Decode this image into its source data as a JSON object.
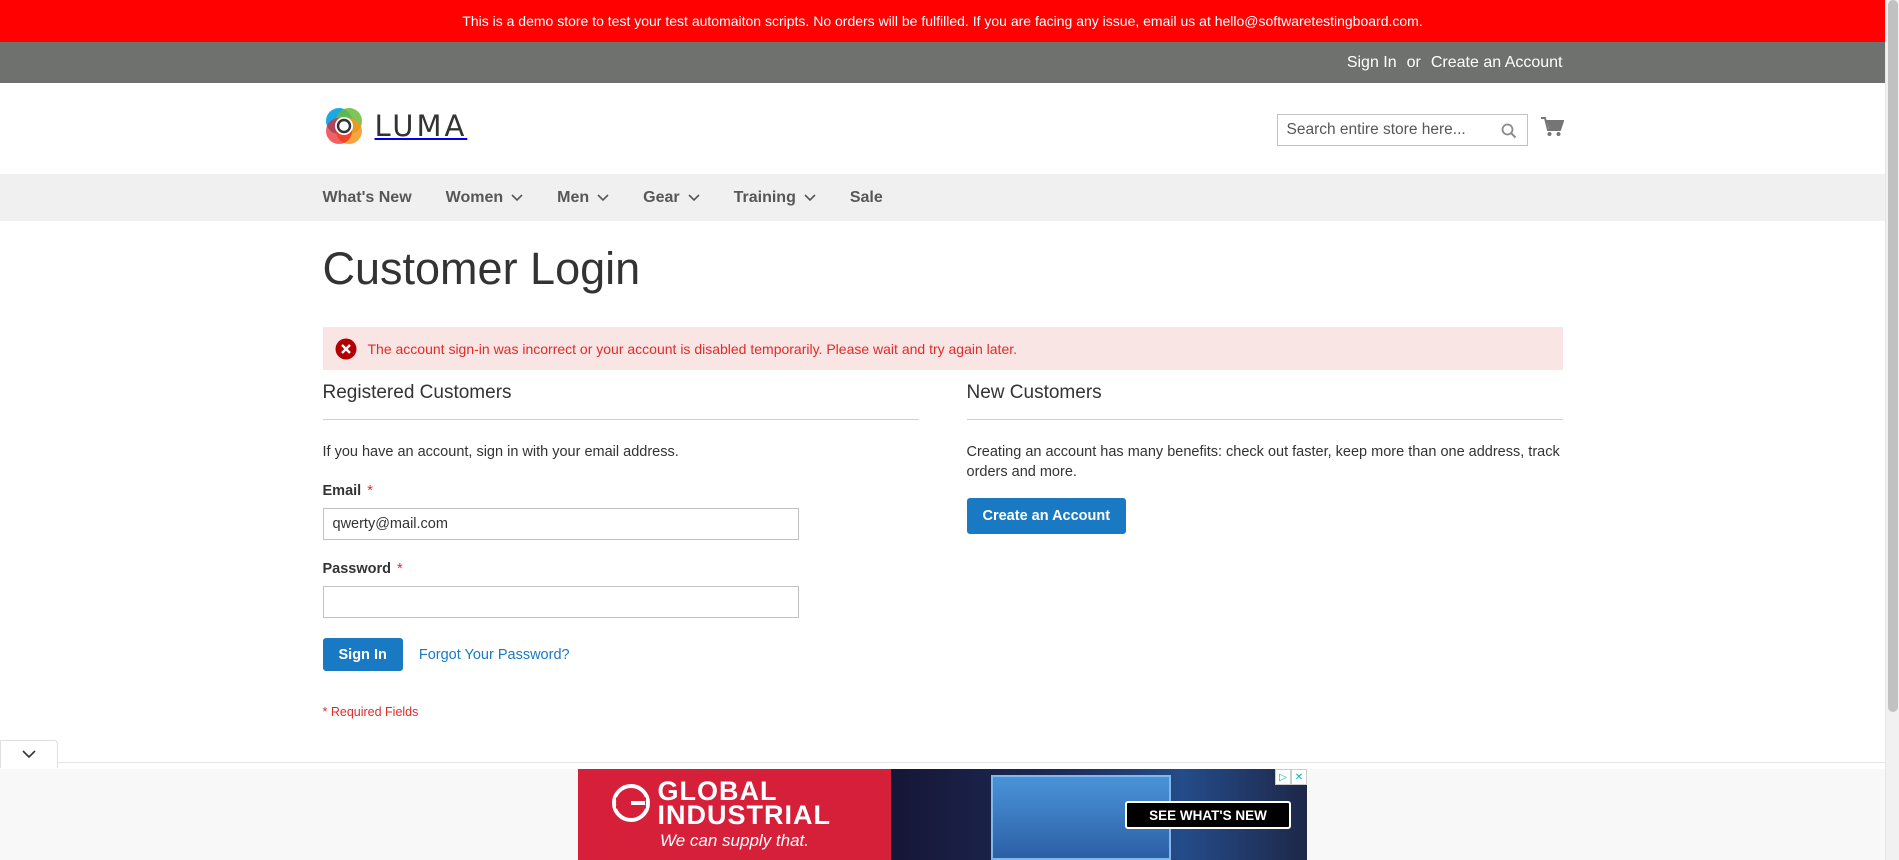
{
  "demo_notice": "This is a demo store to test your test automaiton scripts. No orders will be fulfilled. If you are facing any issue, email us at hello@softwaretestingboard.com.",
  "header_links": {
    "sign_in": "Sign In",
    "or": "or",
    "create_account": "Create an Account"
  },
  "logo": {
    "text": "LUMA"
  },
  "search": {
    "placeholder": "Search entire store here...",
    "value": ""
  },
  "nav": {
    "items": [
      {
        "label": "What's New",
        "has_dropdown": false
      },
      {
        "label": "Women",
        "has_dropdown": true
      },
      {
        "label": "Men",
        "has_dropdown": true
      },
      {
        "label": "Gear",
        "has_dropdown": true
      },
      {
        "label": "Training",
        "has_dropdown": true
      },
      {
        "label": "Sale",
        "has_dropdown": false
      }
    ]
  },
  "page": {
    "title": "Customer Login",
    "error_message": "The account sign-in was incorrect or your account is disabled temporarily. Please wait and try again later."
  },
  "registered": {
    "title": "Registered Customers",
    "intro": "If you have an account, sign in with your email address.",
    "email_label": "Email",
    "email_value": "qwerty@mail.com",
    "password_label": "Password",
    "password_value": "",
    "required_mark": "*",
    "sign_in_button": "Sign In",
    "forgot_link": "Forgot Your Password?",
    "required_note": "* Required Fields"
  },
  "new_customers": {
    "title": "New Customers",
    "text": "Creating an account has many benefits: check out faster, keep more than one address, track orders and more.",
    "button": "Create an Account"
  },
  "ad": {
    "brand": "GLOBAL INDUSTRIAL",
    "tagline": "We can supply that.",
    "cta": "SEE WHAT'S NEW"
  },
  "colors": {
    "demo_bar": "#ff0101",
    "header_bar": "#6e716e",
    "primary": "#1979c3",
    "error_text": "#e02b27",
    "error_bg": "#fae5e5",
    "nav_bg": "#f0f0f0"
  },
  "icons": {
    "search": "search-icon",
    "cart": "cart-icon",
    "error": "error-icon",
    "dropdown": "chevron-down-icon",
    "collapse": "chevron-down-icon"
  }
}
